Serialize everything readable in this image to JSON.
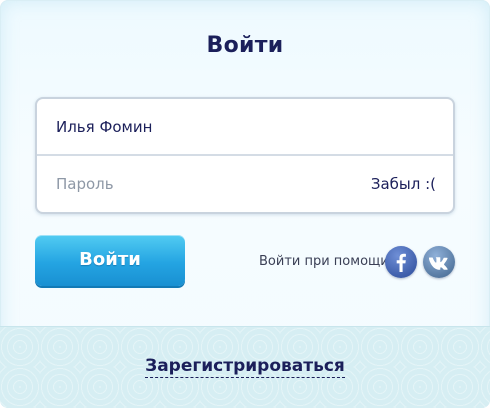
{
  "dialog": {
    "title": "Войти"
  },
  "form": {
    "login_value": "Илья Фомин",
    "password_placeholder": "Пароль",
    "forgot_label": "Забыл :("
  },
  "actions": {
    "login_button_label": "Войти",
    "social_label": "Войти при помощи:",
    "social_buttons": [
      {
        "icon": "facebook-icon",
        "glyph": "f",
        "color": "#3b5ba8"
      },
      {
        "icon": "vk-icon",
        "glyph": "vk",
        "color": "#54779f"
      }
    ]
  },
  "footer": {
    "register_label": "Зарегистрироваться"
  },
  "colors": {
    "accent_text": "#1b1f5a",
    "button_blue": "#24a4e2",
    "footer_bg": "#d6eef3"
  }
}
